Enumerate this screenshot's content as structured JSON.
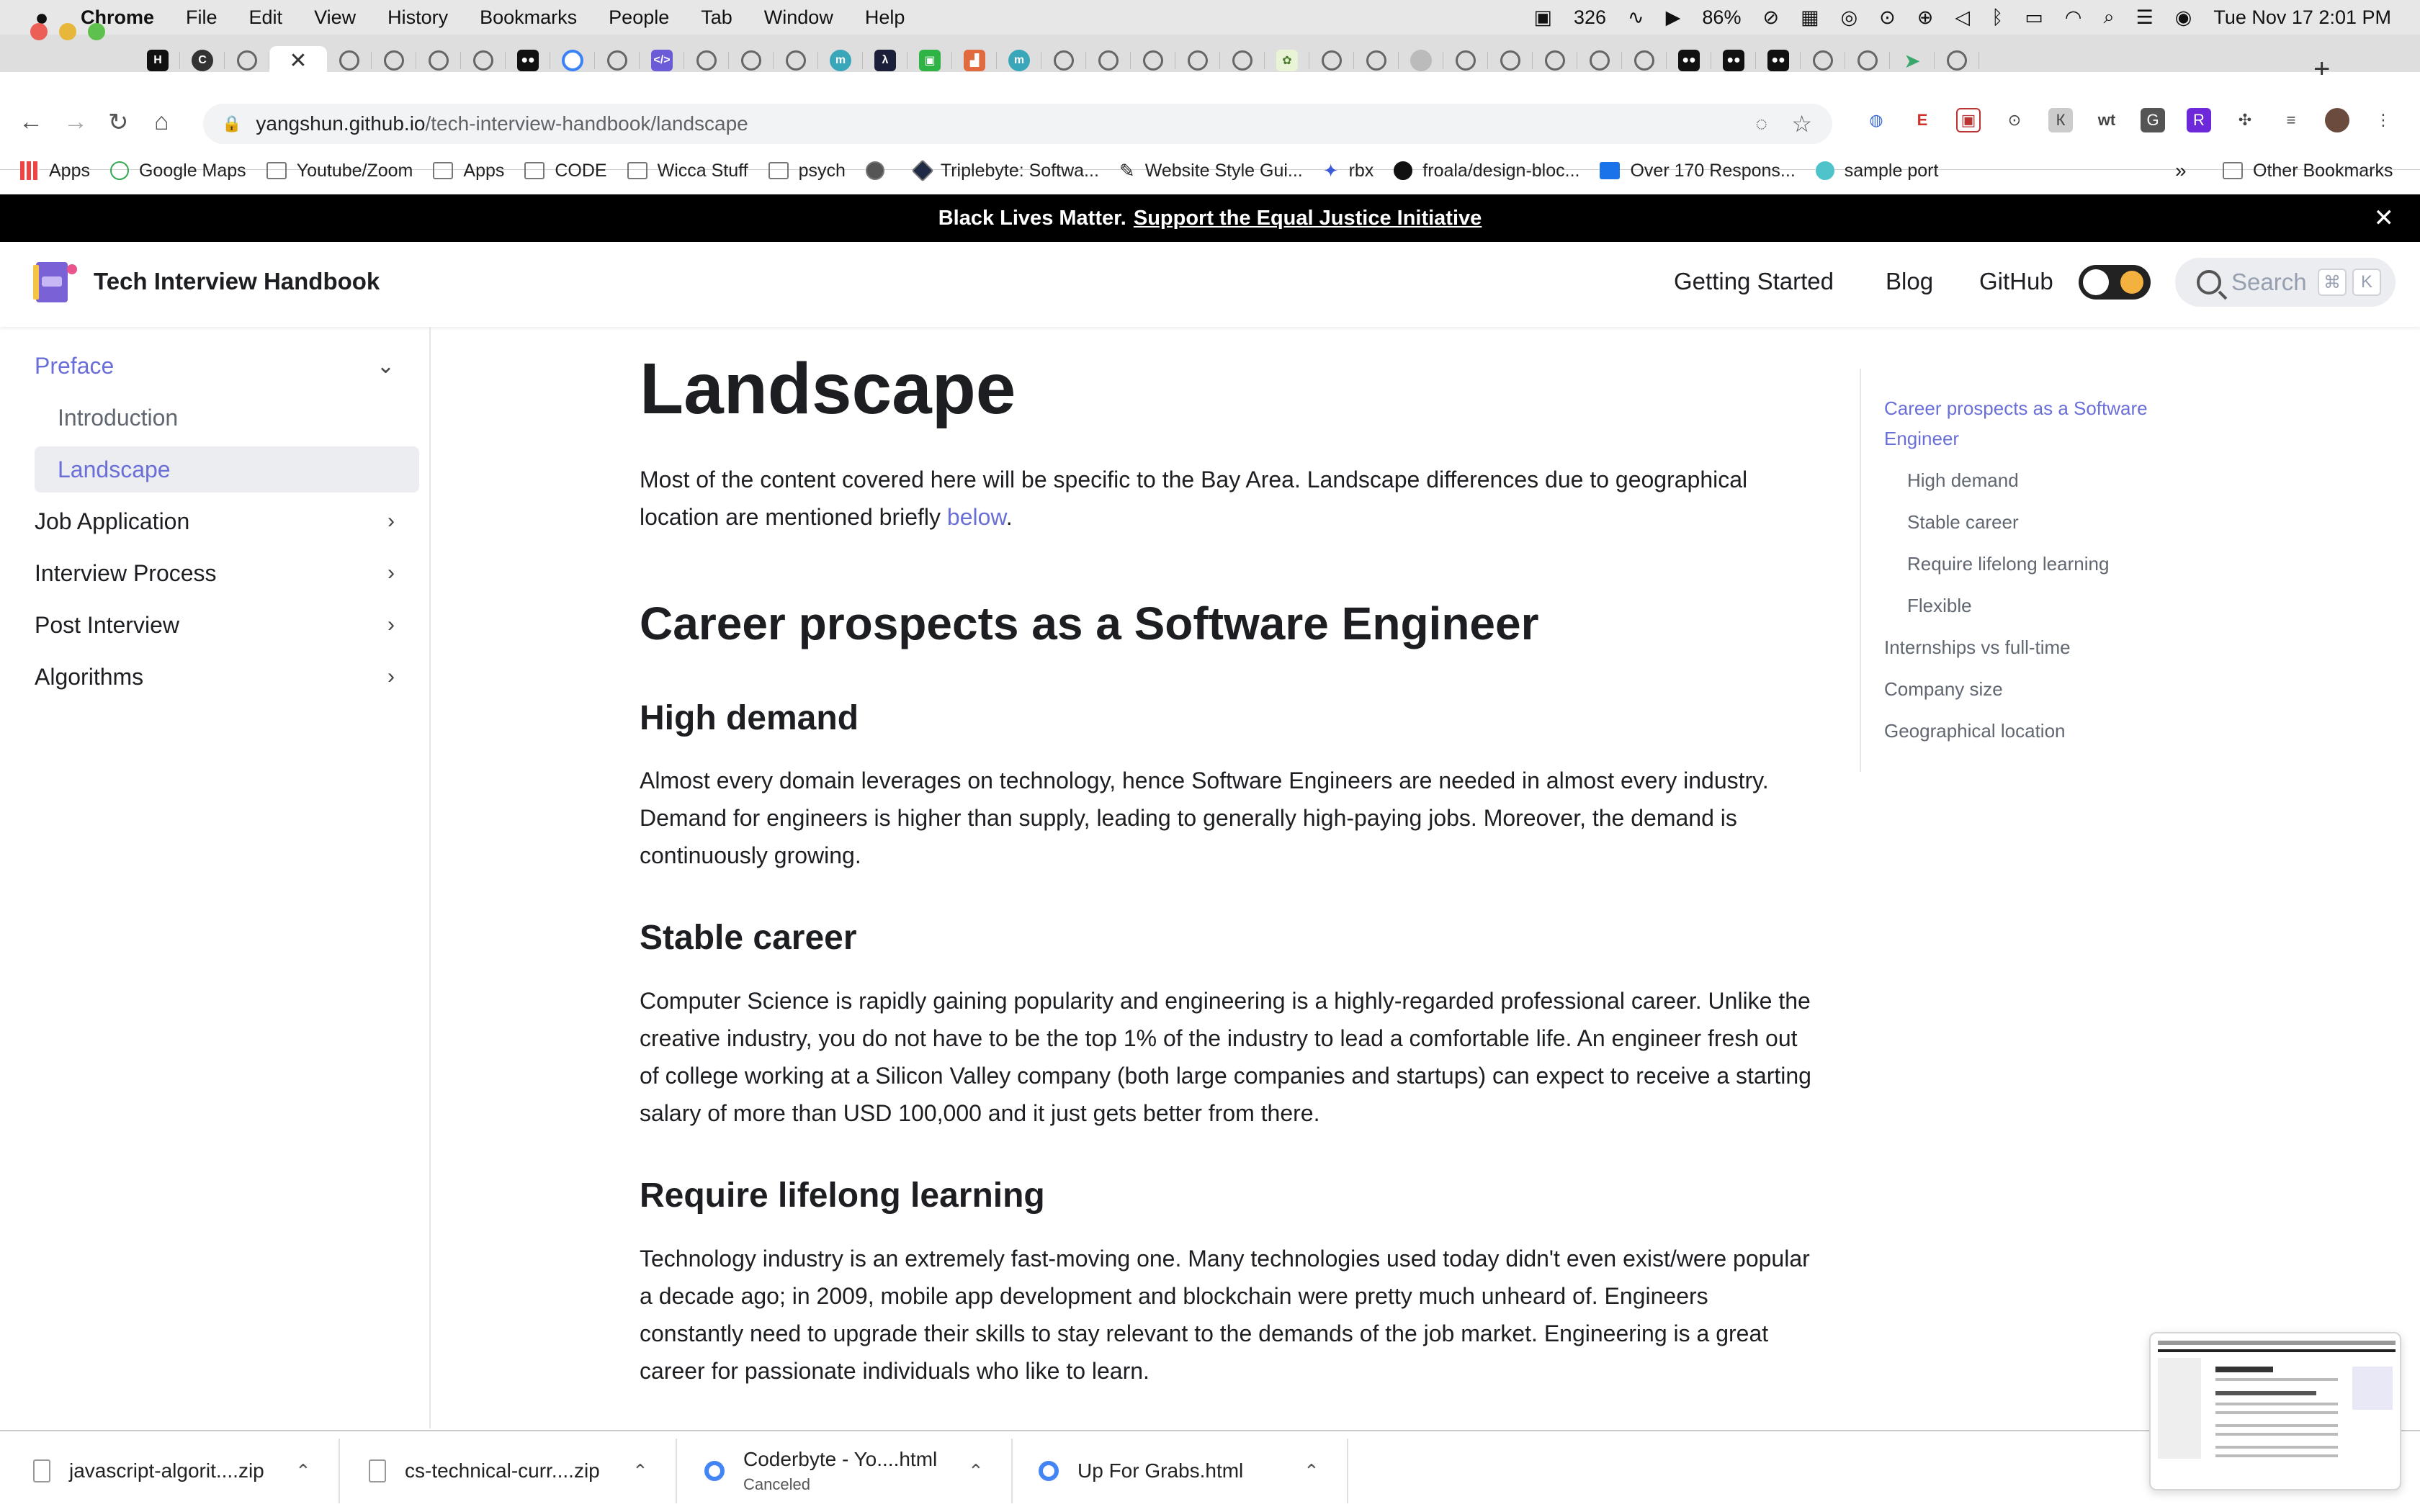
{
  "menubar": {
    "app": "Chrome",
    "items": [
      "File",
      "Edit",
      "View",
      "History",
      "Bookmarks",
      "People",
      "Tab",
      "Window",
      "Help"
    ],
    "cpu": "326",
    "battery": "86%",
    "datetime": "Tue Nov 17  2:01 PM"
  },
  "browser": {
    "url_host": "yangshun.github.io",
    "url_path": "/tech-interview-handbook/landscape",
    "bookmarks": [
      "Apps",
      "Google Maps",
      "Youtube/Zoom",
      "Apps",
      "CODE",
      "Wicca Stuff",
      "psych",
      "",
      "Triplebyte: Softwa...",
      "Website Style Gui...",
      "rbx",
      "froala/design-bloc...",
      "Over 170 Respons...",
      "sample port"
    ],
    "bookmarks_more": "»",
    "other_bookmarks": "Other Bookmarks"
  },
  "banner": {
    "text": "Black Lives Matter.",
    "link": "Support the Equal Justice Initiative"
  },
  "site": {
    "title": "Tech Interview Handbook",
    "nav": [
      "Getting Started",
      "Blog",
      "GitHub"
    ],
    "search_placeholder": "Search",
    "search_keys": [
      "⌘",
      "K"
    ]
  },
  "sidebar": {
    "items": [
      {
        "label": "Preface"
      },
      {
        "label": "Introduction"
      },
      {
        "label": "Landscape"
      },
      {
        "label": "Job Application"
      },
      {
        "label": "Interview Process"
      },
      {
        "label": "Post Interview"
      },
      {
        "label": "Algorithms"
      }
    ]
  },
  "article": {
    "title": "Landscape",
    "intro": "Most of the content covered here will be specific to the Bay Area. Landscape differences due to geographical location are mentioned briefly ",
    "intro_link": "below",
    "h2": "Career prospects as a Software Engineer",
    "sections": [
      {
        "heading": "High demand",
        "text": "Almost every domain leverages on technology, hence Software Engineers are needed in almost every industry. Demand for engineers is higher than supply, leading to generally high-paying jobs. Moreover, the demand is continuously growing."
      },
      {
        "heading": "Stable career",
        "text": "Computer Science is rapidly gaining popularity and engineering is a highly-regarded professional career. Unlike the creative industry, you do not have to be the top 1% of the industry to lead a comfortable life. An engineer fresh out of college working at a Silicon Valley company (both large companies and startups) can expect to receive a starting salary of more than USD 100,000 and it just gets better from there."
      },
      {
        "heading": "Require lifelong learning",
        "text": "Technology industry is an extremely fast-moving one. Many technologies used today didn't even exist/were popular a decade ago; in 2009, mobile app development and blockchain were pretty much unheard of. Engineers constantly need to upgrade their skills to stay relevant to the demands of the job market. Engineering is a great career for passionate individuals who like to learn."
      }
    ]
  },
  "toc": {
    "items": [
      "Career prospects as a Software Engineer",
      "High demand",
      "Stable career",
      "Require lifelong learning",
      "Flexible",
      "Internships vs full-time",
      "Company size",
      "Geographical location"
    ]
  },
  "downloads": [
    {
      "name": "javascript-algorit....zip",
      "status": ""
    },
    {
      "name": "cs-technical-curr....zip",
      "status": ""
    },
    {
      "name": "Coderbyte - Yo....html",
      "status": "Canceled"
    },
    {
      "name": "Up For Grabs.html",
      "status": ""
    }
  ],
  "colors": {
    "accent": "#6a6fd8",
    "banner": "#000000",
    "toggle_sun": "#f3b13f"
  }
}
